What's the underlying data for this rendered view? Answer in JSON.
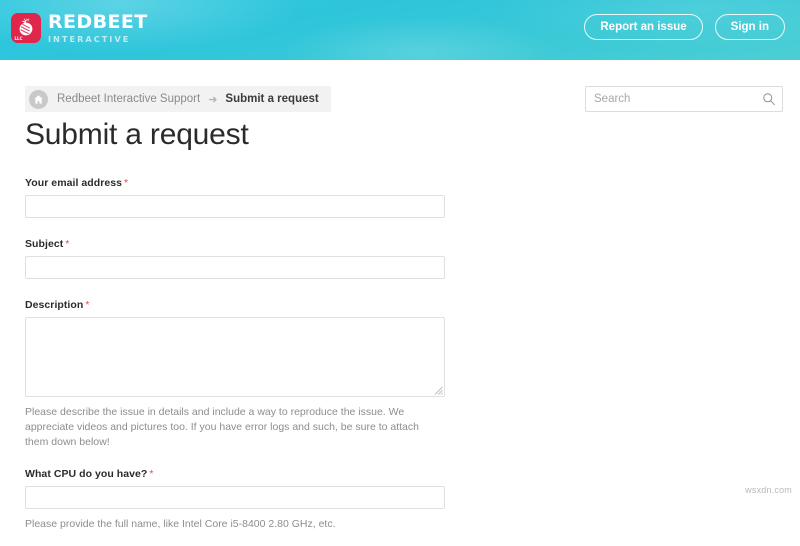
{
  "header": {
    "logo": {
      "icon": "beet-icon",
      "title": "REDBEET",
      "subtitle": "INTERACTIVE",
      "mark_color": "#e0274b",
      "bg_gradient_from": "#2ec8de",
      "bg_gradient_to": "#4ccfd4"
    },
    "actions": [
      {
        "name": "report-an-issue-button",
        "label": "Report an issue"
      },
      {
        "name": "sign-in-button",
        "label": "Sign in"
      }
    ]
  },
  "breadcrumb": {
    "home_icon": "home-icon",
    "items": [
      {
        "label": "Redbeet Interactive Support",
        "current": false
      },
      {
        "label": "Submit a request",
        "current": true
      }
    ],
    "separator": "➜"
  },
  "search": {
    "placeholder": "Search",
    "value": "",
    "icon": "search-icon"
  },
  "main": {
    "title": "Submit a request",
    "fields": [
      {
        "name": "email",
        "label": "Your email address",
        "required": true,
        "required_mark": "*",
        "type": "text",
        "value": "",
        "hint": ""
      },
      {
        "name": "subject",
        "label": "Subject",
        "required": true,
        "required_mark": "*",
        "type": "text",
        "value": "",
        "hint": ""
      },
      {
        "name": "description",
        "label": "Description",
        "required": true,
        "required_mark": "*",
        "type": "textarea",
        "value": "",
        "hint": "Please describe the issue in details and include a way to reproduce the issue. We appreciate videos and pictures too. If you have error logs and such, be sure to attach them down below!"
      },
      {
        "name": "cpu",
        "label": "What CPU do you have?",
        "required": true,
        "required_mark": "*",
        "type": "text",
        "value": "",
        "hint": "Please provide the full name, like Intel Core i5-8400 2.80 GHz, etc."
      }
    ]
  },
  "watermark": {
    "text": "wsxdn.com"
  }
}
